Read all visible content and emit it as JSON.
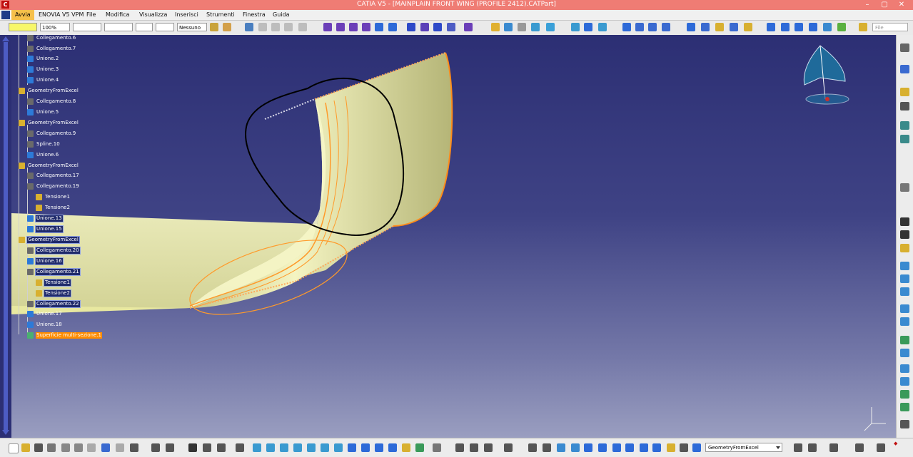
{
  "window": {
    "title": "CATIA V5 - [MAINPLAIN FRONT WING (PROFILE 2412).CATPart]"
  },
  "menu": {
    "start": "Avvia",
    "items": [
      "ENOVIA V5 VPM",
      "File",
      "Modifica",
      "Visualizza",
      "Inserisci",
      "Strumenti",
      "Finestra",
      "Guida"
    ]
  },
  "toolbar": {
    "zoom_value": "100%",
    "layer_value": "Nessuno",
    "file_placeholder": "File"
  },
  "tree": {
    "nodes": [
      {
        "label": "Collegamento.6"
      },
      {
        "label": "Collegamento.7"
      },
      {
        "label": "Unione.2"
      },
      {
        "label": "Unione.3"
      },
      {
        "label": "Unione.4"
      },
      {
        "label": "GeometryFromExcel"
      },
      {
        "label": "Collegamento.8"
      },
      {
        "label": "Unione.5"
      },
      {
        "label": "GeometryFromExcel"
      },
      {
        "label": "Collegamento.9"
      },
      {
        "label": "Spline.10"
      },
      {
        "label": "Unione.6"
      },
      {
        "label": "GeometryFromExcel"
      },
      {
        "label": "Collegamento.17"
      },
      {
        "label": "Collegamento.19"
      },
      {
        "label": "Tensione1"
      },
      {
        "label": "Tensione2"
      },
      {
        "label": "Unione.13"
      },
      {
        "label": "Unione.15"
      },
      {
        "label": "GeometryFromExcel"
      },
      {
        "label": "Collegamento.20"
      },
      {
        "label": "Unione.16"
      },
      {
        "label": "Collegamento.21"
      },
      {
        "label": "Tensione1"
      },
      {
        "label": "Tensione2"
      },
      {
        "label": "Collegamento.22"
      },
      {
        "label": "Unione.17"
      },
      {
        "label": "Unione.18"
      },
      {
        "label": "Superficie multi-sezione.1"
      }
    ]
  },
  "bottom": {
    "geometry_combo": "GeometryFromExcel"
  },
  "colors": {
    "title_bar": "#ef7c74",
    "start_button": "#f6c04a",
    "viewport_top": "#2c2f74",
    "viewport_bottom": "#9a9ec0",
    "surface": "#e9e9a8",
    "edge": "#ff8c1a",
    "active_node": "#ff8c00"
  },
  "icons": [
    "search-icon",
    "zoom-icon",
    "rotate-icon",
    "pan-icon",
    "fly-icon",
    "normal-view-icon",
    "compass-icon",
    "axis-icon"
  ]
}
